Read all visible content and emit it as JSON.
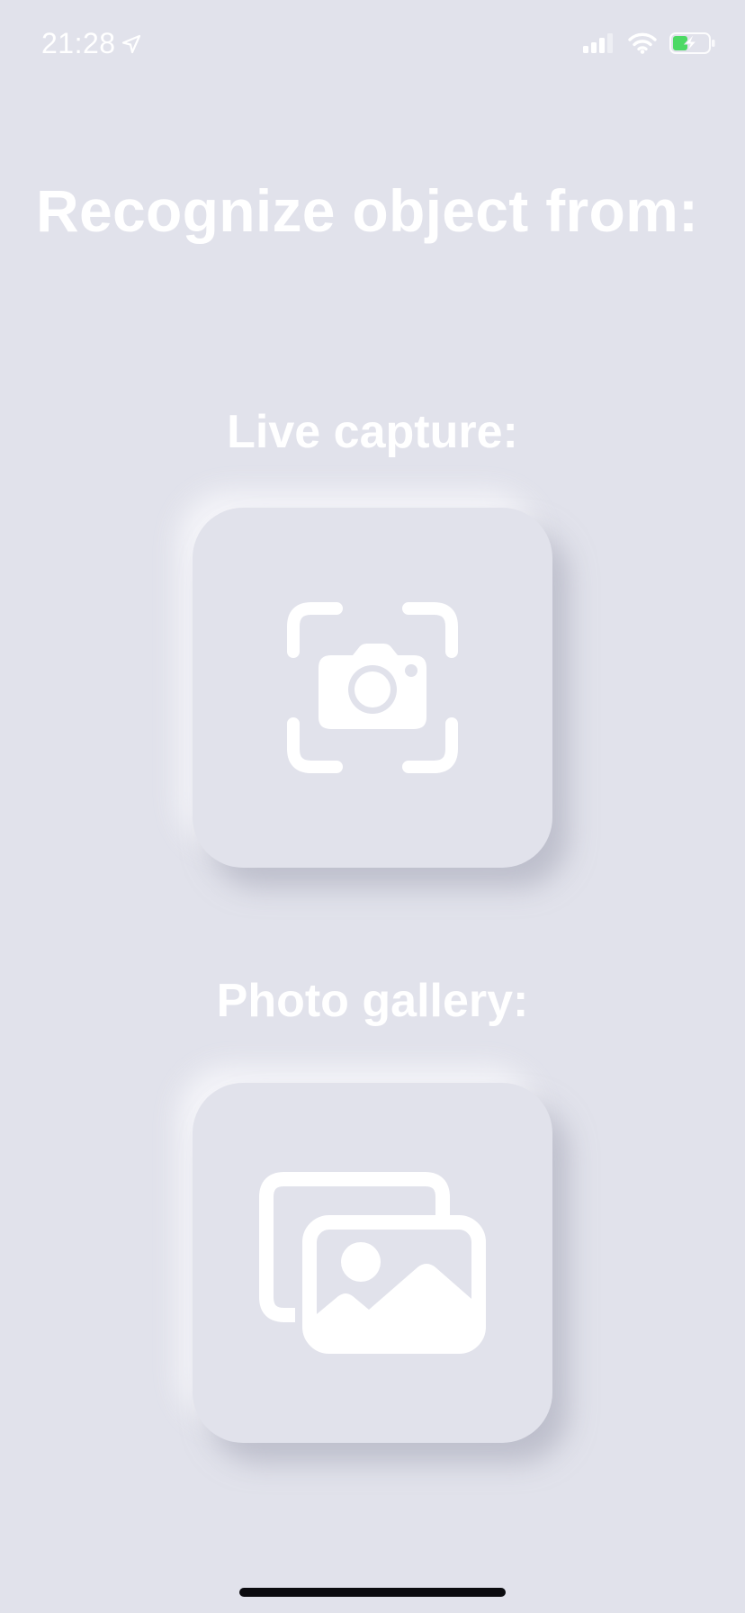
{
  "status_bar": {
    "time": "21:28",
    "location_icon": "location-arrow-icon",
    "signal_icon": "cellular-signal-icon",
    "wifi_icon": "wifi-icon",
    "battery_icon": "battery-charging-icon",
    "battery_color": "#4CD964"
  },
  "page": {
    "title": "Recognize object from:",
    "background_color": "#E1E2EB"
  },
  "live_capture": {
    "label": "Live capture:",
    "icon": "camera-viewfinder-icon"
  },
  "photo_gallery": {
    "label": "Photo gallery:",
    "icon": "photo-stack-icon"
  }
}
